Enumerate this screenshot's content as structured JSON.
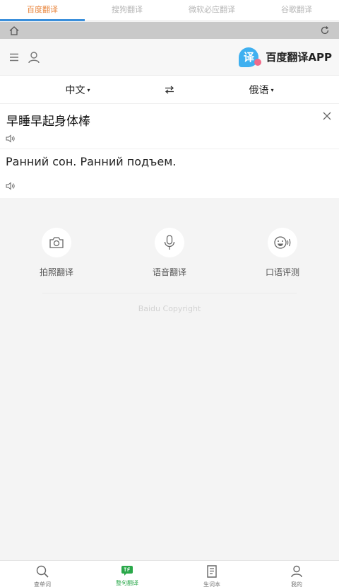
{
  "engine_tabs": [
    {
      "label": "百度翻译",
      "active": true
    },
    {
      "label": "搜狗翻译",
      "active": false
    },
    {
      "label": "微软必应翻译",
      "active": false
    },
    {
      "label": "谷歌翻译",
      "active": false
    }
  ],
  "header": {
    "brand_logo_char": "译",
    "brand_name": "百度翻译APP"
  },
  "languages": {
    "source": "中文",
    "target": "俄语",
    "caret": "▾"
  },
  "source": {
    "text": "早睡早起身体棒"
  },
  "result": {
    "text": "Ранний сон. Ранний подъем."
  },
  "tools": [
    {
      "label": "拍照翻译",
      "icon": "camera-icon"
    },
    {
      "label": "语音翻译",
      "icon": "microphone-icon"
    },
    {
      "label": "口语评测",
      "icon": "speaking-icon"
    }
  ],
  "copyright": "Baidu Copyright",
  "bottom_nav": [
    {
      "label": "查单词",
      "icon": "search-icon",
      "active": false
    },
    {
      "label": "整句翻译",
      "icon": "translate-icon",
      "active": true
    },
    {
      "label": "生词本",
      "icon": "notebook-icon",
      "active": false
    },
    {
      "label": "我的",
      "icon": "user-icon",
      "active": false
    }
  ],
  "colors": {
    "active_tab": "#e8843b",
    "tab_indicator": "#3a8fdb",
    "active_nav": "#2aa84a"
  }
}
